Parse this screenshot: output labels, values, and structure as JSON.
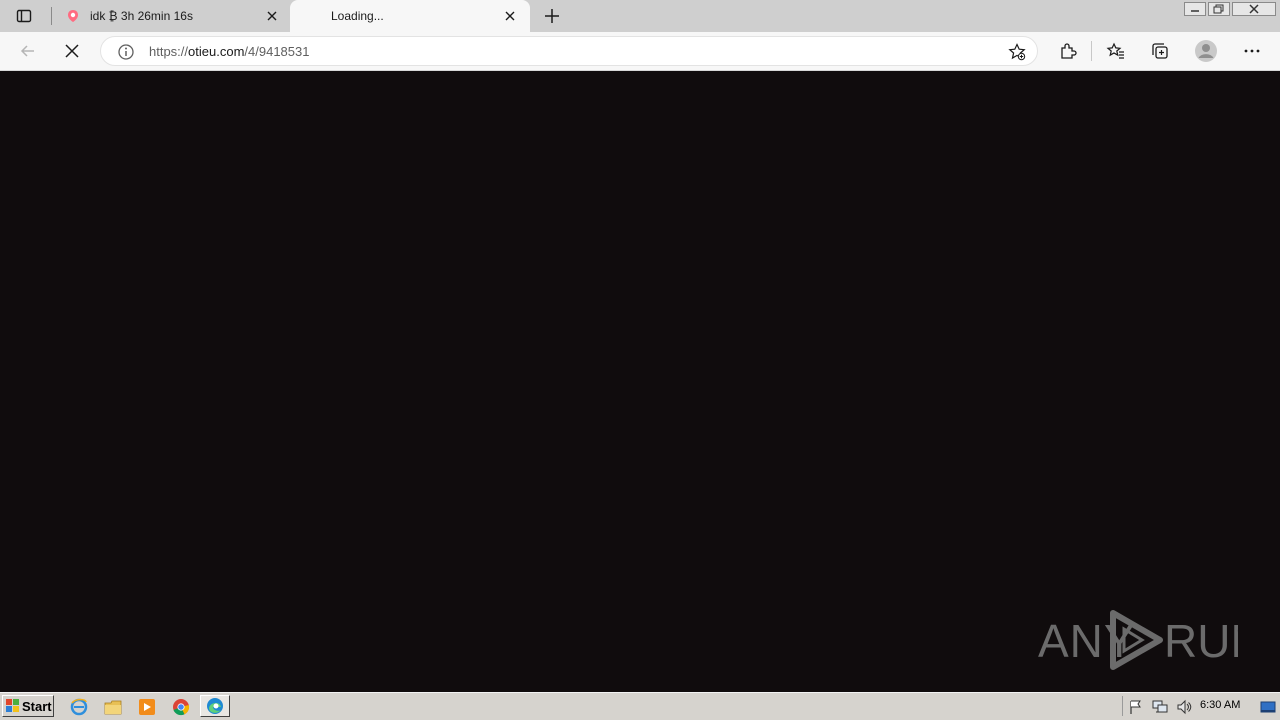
{
  "browser": {
    "tabs": [
      {
        "title": "idk ₿ 3h 26min 16s",
        "icon": "tab-favicon-icon",
        "active": false
      },
      {
        "title": "Loading...",
        "icon": "",
        "active": true
      }
    ],
    "url_scheme": "https://",
    "url_host": "otieu.com",
    "url_path": "/4/9418531",
    "accent": "#ff6b81"
  },
  "content": {
    "background": "#100c0d",
    "watermark": "ANY RUN"
  },
  "taskbar": {
    "start_label": "Start",
    "clock": "6:30 AM",
    "apps": [
      "ie-icon",
      "explorer-icon",
      "media-player-icon",
      "chrome-icon",
      "edge-icon"
    ]
  }
}
